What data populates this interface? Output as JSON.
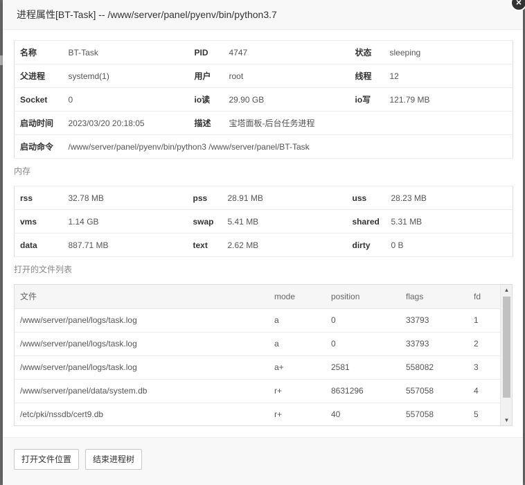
{
  "dialog": {
    "title": "进程属性[BT-Task] -- /www/server/panel/pyenv/bin/python3.7",
    "close_glyph": "×"
  },
  "info": {
    "rows": [
      [
        {
          "k": "名称",
          "v": "BT-Task"
        },
        {
          "k": "PID",
          "v": "4747"
        },
        {
          "k": "状态",
          "v": "sleeping"
        }
      ],
      [
        {
          "k": "父进程",
          "v": "systemd(1)"
        },
        {
          "k": "用户",
          "v": "root"
        },
        {
          "k": "线程",
          "v": "12"
        }
      ],
      [
        {
          "k": "Socket",
          "v": "0"
        },
        {
          "k": "io读",
          "v": "29.90 GB"
        },
        {
          "k": "io写",
          "v": "121.79 MB"
        }
      ]
    ],
    "start_time": {
      "k": "启动时间",
      "v": "2023/03/20 20:18:05"
    },
    "desc": {
      "k": "描述",
      "v": "宝塔面板-后台任务进程"
    },
    "cmd": {
      "k": "启动命令",
      "v": "/www/server/panel/pyenv/bin/python3 /www/server/panel/BT-Task"
    }
  },
  "memory": {
    "title": "内存",
    "rows": [
      [
        {
          "k": "rss",
          "v": "32.78 MB"
        },
        {
          "k": "pss",
          "v": "28.91 MB"
        },
        {
          "k": "uss",
          "v": "28.23 MB"
        }
      ],
      [
        {
          "k": "vms",
          "v": "1.14 GB"
        },
        {
          "k": "swap",
          "v": "5.41 MB"
        },
        {
          "k": "shared",
          "v": "5.31 MB"
        }
      ],
      [
        {
          "k": "data",
          "v": "887.71 MB"
        },
        {
          "k": "text",
          "v": "2.62 MB"
        },
        {
          "k": "dirty",
          "v": "0 B"
        }
      ]
    ]
  },
  "files": {
    "title": "打开的文件列表",
    "columns": [
      "文件",
      "mode",
      "position",
      "flags",
      "fd"
    ],
    "rows": [
      [
        "/www/server/panel/logs/task.log",
        "a",
        "0",
        "33793",
        "1"
      ],
      [
        "/www/server/panel/logs/task.log",
        "a",
        "0",
        "33793",
        "2"
      ],
      [
        "/www/server/panel/logs/task.log",
        "a+",
        "2581",
        "558082",
        "3"
      ],
      [
        "/www/server/panel/data/system.db",
        "r+",
        "8631296",
        "557058",
        "4"
      ],
      [
        "/etc/pki/nssdb/cert9.db",
        "r+",
        "40",
        "557058",
        "5"
      ]
    ]
  },
  "footer": {
    "open_location": "打开文件位置",
    "kill_tree": "结束进程树"
  }
}
